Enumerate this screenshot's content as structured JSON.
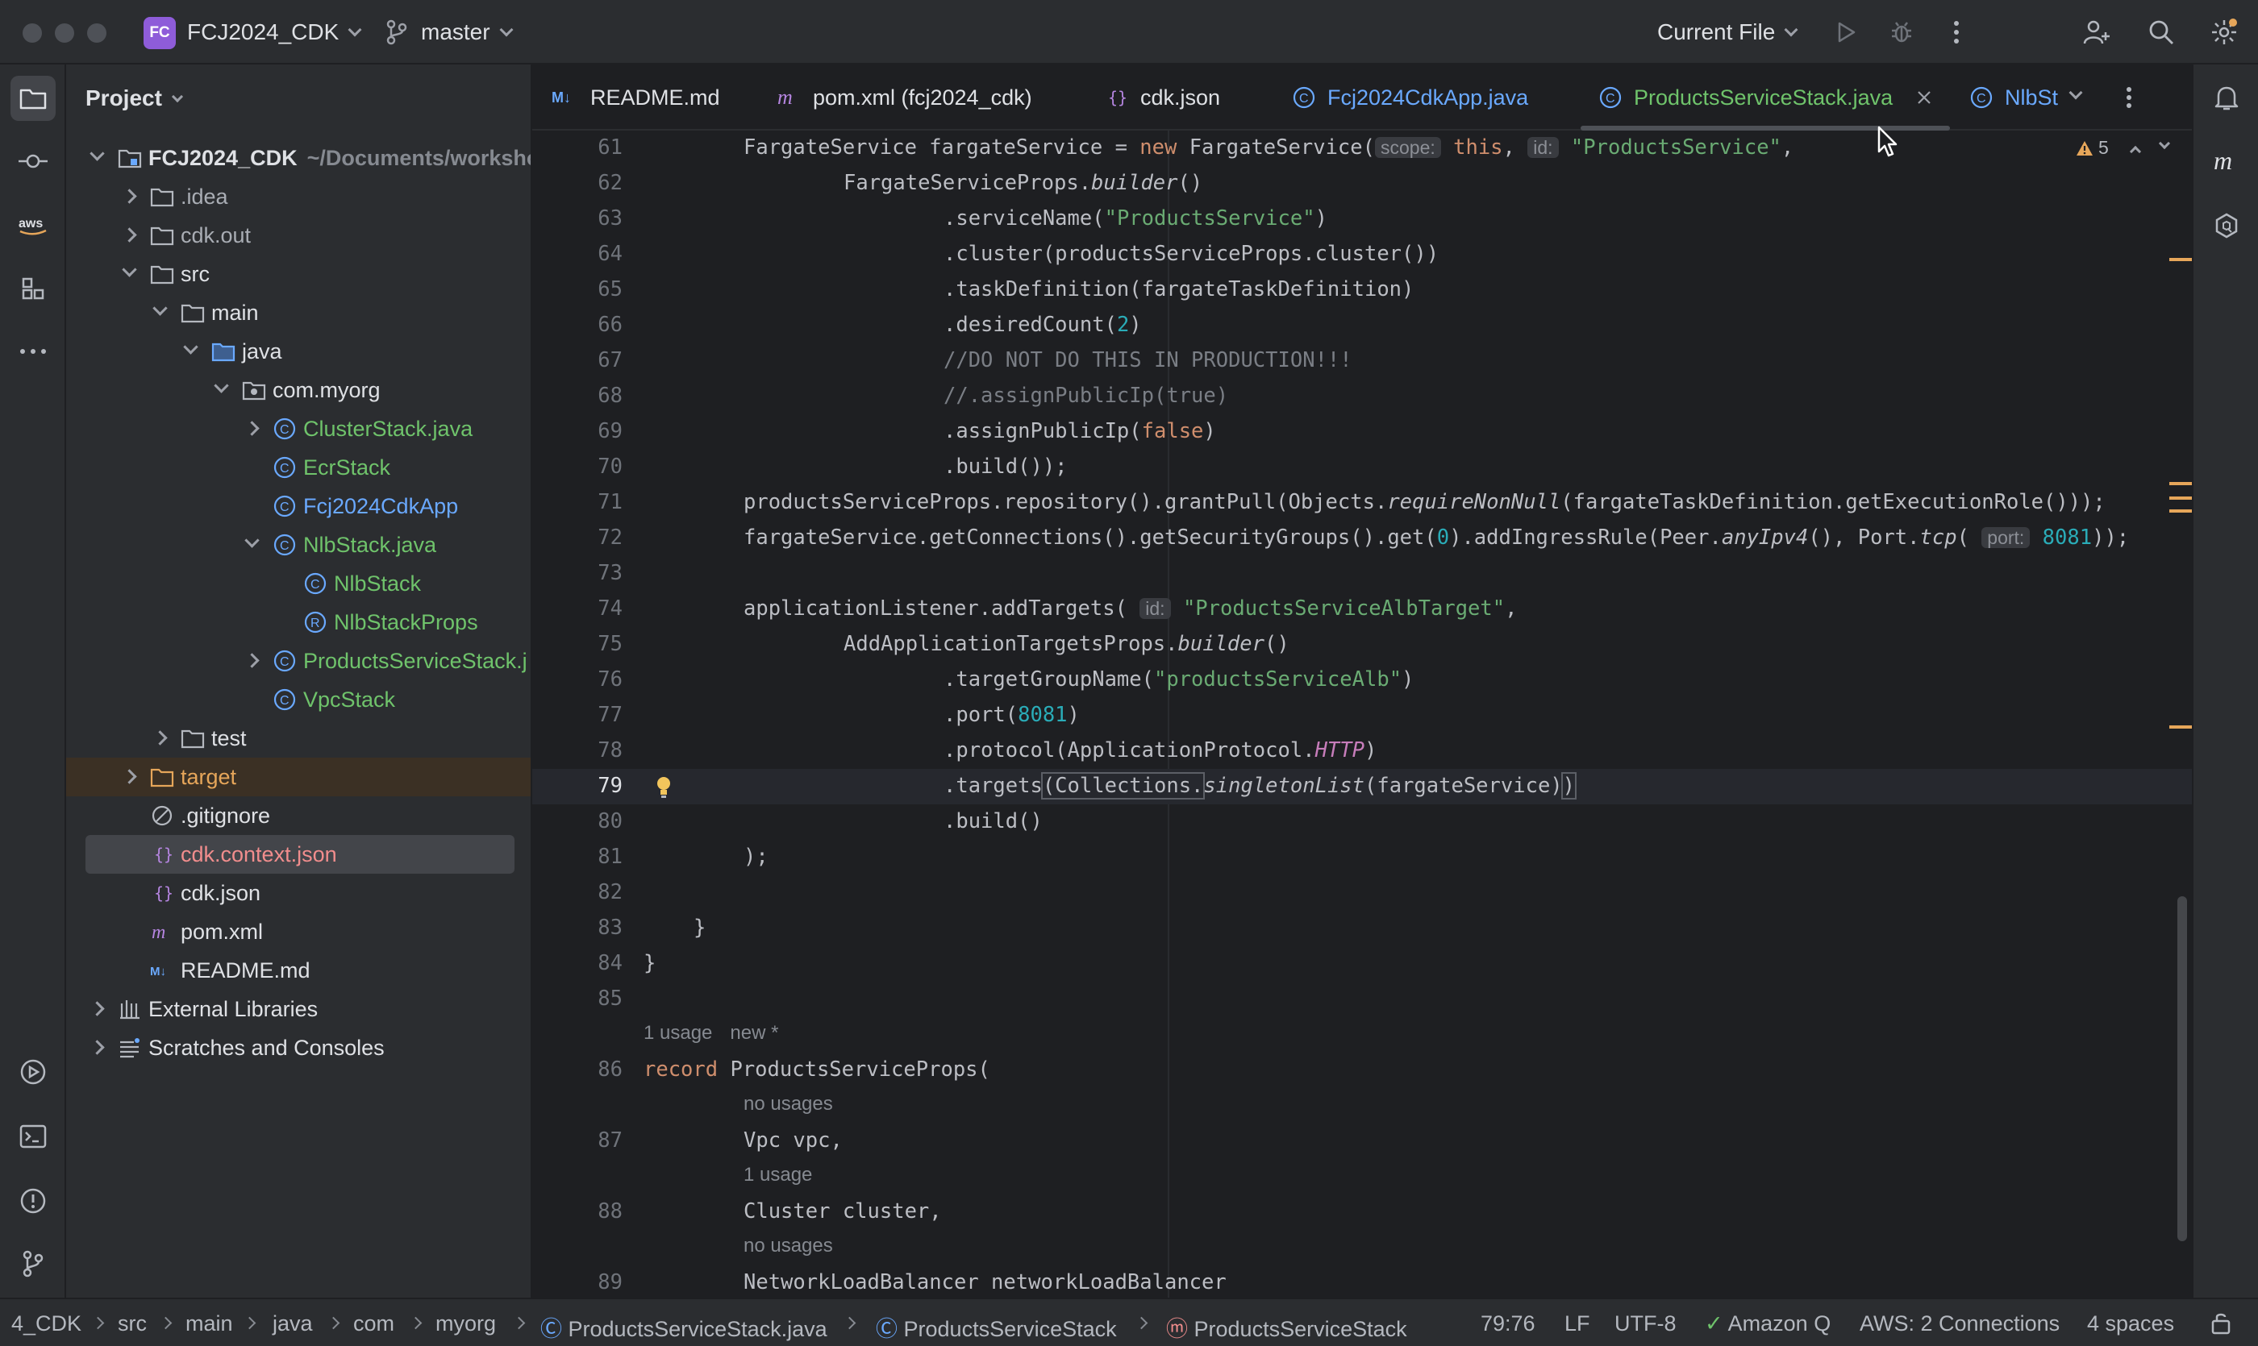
{
  "titlebar": {
    "project_badge": "FC",
    "project_name": "FCJ2024_CDK",
    "branch": "master",
    "run_config": "Current File"
  },
  "project_panel": {
    "title": "Project",
    "tree": [
      {
        "label": "FCJ2024_CDK",
        "suffix": "~/Documents/worksho"
      },
      {
        "label": ".idea"
      },
      {
        "label": "cdk.out"
      },
      {
        "label": "src"
      },
      {
        "label": "main"
      },
      {
        "label": "java"
      },
      {
        "label": "com.myorg"
      },
      {
        "label": "ClusterStack.java"
      },
      {
        "label": "EcrStack"
      },
      {
        "label": "Fcj2024CdkApp"
      },
      {
        "label": "NlbStack.java"
      },
      {
        "label": "NlbStack"
      },
      {
        "label": "NlbStackProps"
      },
      {
        "label": "ProductsServiceStack.j"
      },
      {
        "label": "VpcStack"
      },
      {
        "label": "test"
      },
      {
        "label": "target"
      },
      {
        "label": ".gitignore"
      },
      {
        "label": "cdk.context.json"
      },
      {
        "label": "cdk.json"
      },
      {
        "label": "pom.xml"
      },
      {
        "label": "README.md"
      },
      {
        "label": "External Libraries"
      },
      {
        "label": "Scratches and Consoles"
      }
    ]
  },
  "tabs": [
    {
      "label": "README.md",
      "icon": "markdown-icon"
    },
    {
      "label": "pom.xml (fcj2024_cdk)",
      "icon": "maven-icon"
    },
    {
      "label": "cdk.json",
      "icon": "json-icon"
    },
    {
      "label": "Fcj2024CdkApp.java",
      "icon": "class-icon"
    },
    {
      "label": "ProductsServiceStack.java",
      "icon": "class-icon",
      "active": true
    },
    {
      "label": "NlbStacl",
      "icon": "class-icon"
    }
  ],
  "editor": {
    "warnings_count": "5",
    "hints": {
      "usage_1": "1 usage",
      "new": "new *",
      "no_usages": "no usages",
      "one_usage": "1 usage"
    },
    "inlay": {
      "scope": "scope:",
      "id": "id:",
      "port": "port:"
    },
    "lines": {
      "n61": "61",
      "n62": "62",
      "n63": "63",
      "n64": "64",
      "n65": "65",
      "n66": "66",
      "n67": "67",
      "n68": "68",
      "n69": "69",
      "n70": "70",
      "n71": "71",
      "n72": "72",
      "n73": "73",
      "n74": "74",
      "n75": "75",
      "n76": "76",
      "n77": "77",
      "n78": "78",
      "n79": "79",
      "n80": "80",
      "n81": "81",
      "n82": "82",
      "n83": "83",
      "n84": "84",
      "n85": "85",
      "n86": "86",
      "n87": "87",
      "n88": "88",
      "n89": "89"
    },
    "tokens": {
      "fargateServiceDecl": "FargateService fargateService = ",
      "new": "new",
      "fargateServiceCtor": " FargateService(",
      "this": "this",
      "productsServiceStr": "\"ProductsService\"",
      "propsBuilder": "FargateServiceProps.",
      "builder": "builder",
      "parens": "()",
      "serviceName": ".serviceName(",
      "cluster": ".cluster(productsServiceProps.cluster())",
      "taskDefinition": ".taskDefinition(fargateTaskDefinition)",
      "desiredCount": ".desiredCount(",
      "two": "2",
      "comment1": "//DO NOT DO THIS IN PRODUCTION!!!",
      "comment2": "//.assignPublicIp(true)",
      "assignPublicIp": ".assignPublicIp(",
      "false": "false",
      "buildClose": ".build());",
      "grantPull": "productsServiceProps.repository().grantPull(Objects.",
      "requireNonNull": "requireNonNull",
      "grantPullRest": "(fargateTaskDefinition.getExecutionRole()));",
      "connections": "fargateService.getConnections().getSecurityGroups().get(",
      "zero": "0",
      "ingress": ").addIngressRule(Peer.",
      "anyIpv4": "anyIpv4",
      "portTcp": "(), Port.",
      "tcp": "tcp",
      "port8081": "8081",
      "closeParens": "));",
      "addTargets": "applicationListener.addTargets(",
      "albTargetStr": "\"ProductsServiceAlbTarget\"",
      "addAppProps": "AddApplicationTargetsProps.",
      "targetGroupName": ".targetGroupName(",
      "albStr": "\"productsServiceAlb\"",
      "port": ".port(",
      "protocol": ".protocol(ApplicationProtocol.",
      "http": "HTTP",
      "targetsOpen": ".targets",
      "collections": "(Collections.",
      "singletonList": "singletonList",
      "targetsArg": "(fargateService)",
      "build": ".build()",
      "closeCall": ");",
      "brace": "}",
      "record": "record",
      "recordName": " ProductsServiceProps(",
      "vpc": "Vpc vpc,",
      "cluster2": "Cluster cluster,",
      "nlb": "NetworkLoadBalancer networkLoadBalancer"
    }
  },
  "statusbar": {
    "crumbs": [
      "4_CDK",
      "src",
      "main",
      "java",
      "com",
      "myorg",
      "ProductsServiceStack.java",
      "ProductsServiceStack",
      "ProductsServiceStack"
    ],
    "position": "79:76",
    "line_sep": "LF",
    "encoding": "UTF-8",
    "amazon_q": "Amazon Q",
    "aws": "AWS: 2 Connections",
    "indent": "4 spaces"
  },
  "colors": {
    "accent_green": "#6fc36b",
    "modified_orange": "#e6a65a",
    "string_green": "#6aab73",
    "keyword_orange": "#cf8e6d",
    "number_teal": "#2aacb8"
  }
}
